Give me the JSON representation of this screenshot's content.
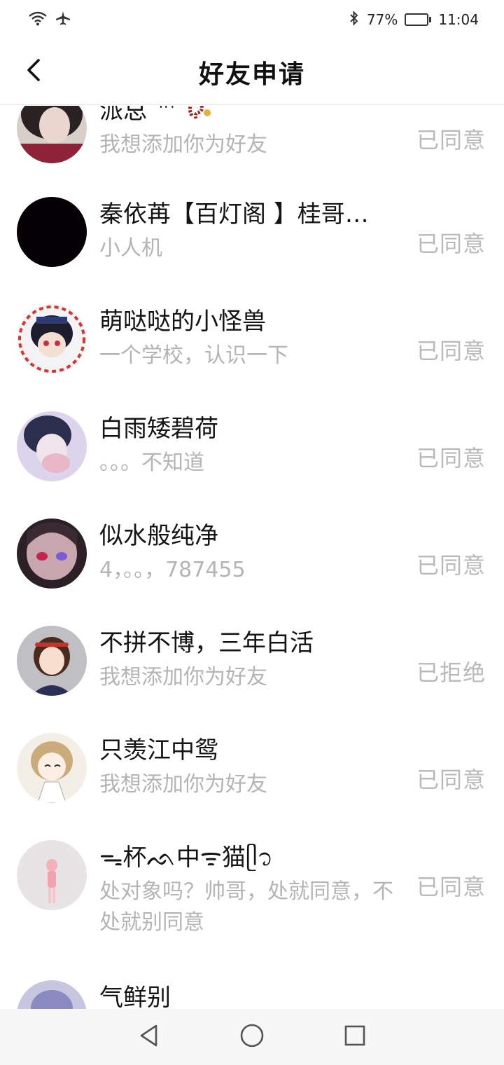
{
  "status_bar": {
    "bluetooth_icon": "bluetooth-icon",
    "battery_percent": "77%",
    "time": "11:04",
    "icons_left": [
      "wifi-icon",
      "airplane-icon"
    ]
  },
  "header": {
    "title": "好友申请",
    "back_icon": "chevron-left-icon"
  },
  "requests": [
    {
      "name": "派总 ™ ",
      "message": "我想添加你为好友",
      "status": "已同意"
    },
    {
      "name": "秦依苒【百灯阁 】桂哥…",
      "message": "小人机",
      "status": "已同意"
    },
    {
      "name": "萌哒哒的小怪兽",
      "message": "一个学校，认识一下",
      "status": "已同意"
    },
    {
      "name": "白雨矮碧荷",
      "message": "。。。不知道",
      "status": "已同意"
    },
    {
      "name": "似水般纯净",
      "message": "4，。。，787455",
      "status": "已同意"
    },
    {
      "name": "不拼不博，三年白活",
      "message": "我想添加你为好友",
      "status": "已拒绝"
    },
    {
      "name": "只羡江中鸳",
      "message": "我想添加你为好友",
      "status": "已同意"
    },
    {
      "name": "ᯓ杯ᨒ中ᯤ猫ᥫ᭡",
      "message": "处对象吗？帅哥，处就同意，不处就别同意",
      "status": "已同意"
    },
    {
      "name": "气鲜别",
      "message": "",
      "status": ""
    }
  ],
  "colors": {
    "name_text": "#141414",
    "message_text": "#b4b4b4",
    "status_text": "#b9b9b9",
    "divider": "#e6e6e6",
    "nav_bar_bg": "#f7f7f7"
  },
  "nav_bar": {
    "icons": [
      "back-triangle-icon",
      "home-circle-icon",
      "recents-square-icon"
    ]
  }
}
